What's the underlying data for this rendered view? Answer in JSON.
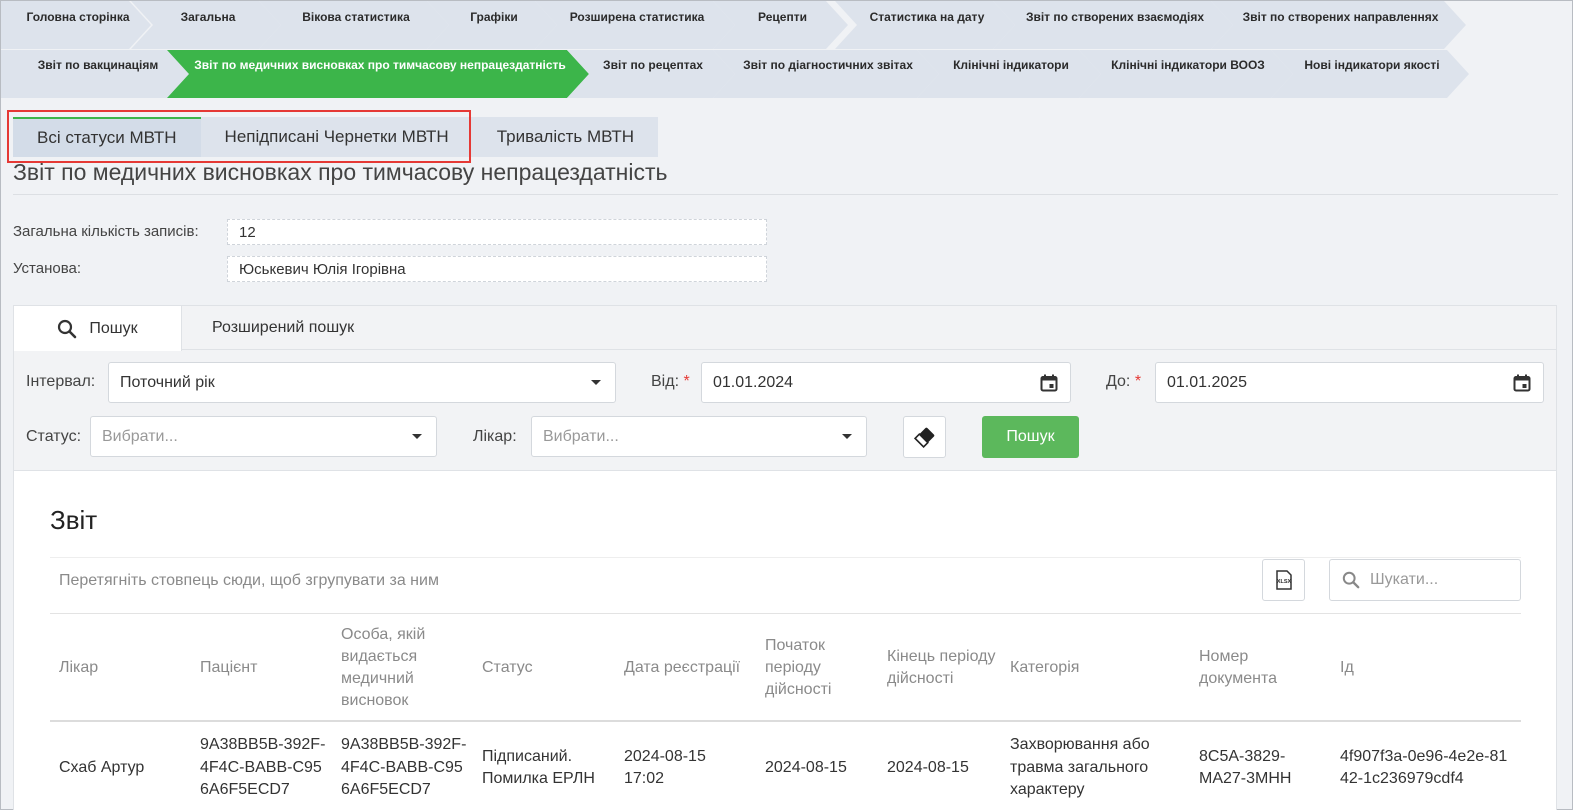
{
  "nav": {
    "row1": [
      "Головна сторінка",
      "Загальна",
      "Вікова статистика",
      "Графіки",
      "Розширена статистика",
      "Рецепти",
      "Статистика на дату",
      "Звіт по створених взаємодіях",
      "Звіт по створених направленнях"
    ],
    "row2": [
      "Звіт по вакцинаціям",
      "Звіт по медичних висновках про тимчасову непрацездатність",
      "Звіт по рецептах",
      "Звіт по діагностичних звітах",
      "Клінічні індикатори",
      "Клінічні індикатори ВООЗ",
      "Нові індикатори якості"
    ]
  },
  "subtabs": [
    "Всі статуси МВТН",
    "Непідписані Чернетки МВТН",
    "Тривалість МВТН"
  ],
  "page_title": "Звіт по медичних висновках про тимчасову непрацездатність",
  "info": {
    "total_label": "Загальна кількість записів:",
    "total_value": "12",
    "inst_label": "Установа:",
    "inst_value": "Юськевич Юлія Ігорівна"
  },
  "search": {
    "tab_basic": "Пошук",
    "tab_advanced": "Розширений пошук",
    "interval_label": "Інтервал:",
    "interval_value": "Поточний рік",
    "from_label": "Від:",
    "from_value": "01.01.2024",
    "to_label": "До:",
    "to_value": "01.01.2025",
    "required_mark": "*",
    "status_label": "Статус:",
    "status_placeholder": "Вибрати...",
    "doctor_label": "Лікар:",
    "doctor_placeholder": "Вибрати...",
    "search_button": "Пошук"
  },
  "report": {
    "title": "Звіт",
    "group_hint": "Перетягніть стовпець сюди, щоб згрупувати за ним",
    "search_placeholder": "Шукати...",
    "columns": [
      "Лікар",
      "Пацієнт",
      "Особа, якій видається медичний висновок",
      "Статус",
      "Дата реєстрації",
      "Початок періоду дійсності",
      "Кінець періоду дійсності",
      "Категорія",
      "Номер документа",
      "Ід"
    ],
    "rows": [
      [
        "Схаб Артур",
        "9A38BB5B-392F-4F4C-BABB-C956A6F5ECD7",
        "9A38BB5B-392F-4F4C-BABB-C956A6F5ECD7",
        "Підписаний. Помилка ЕРЛН",
        "2024-08-15 17:02",
        "2024-08-15",
        "2024-08-15",
        "Захворювання або травма загального характеру",
        "8C5A-3829-MA27-3MHH",
        "4f907f3a-0e96-4e2e-8142-1c236979cdf4"
      ]
    ]
  },
  "colors": {
    "accent_green": "#3cb54a",
    "button_green": "#5cb85c",
    "highlight_red": "#e53935",
    "nav_bg": "#dde3ec"
  }
}
